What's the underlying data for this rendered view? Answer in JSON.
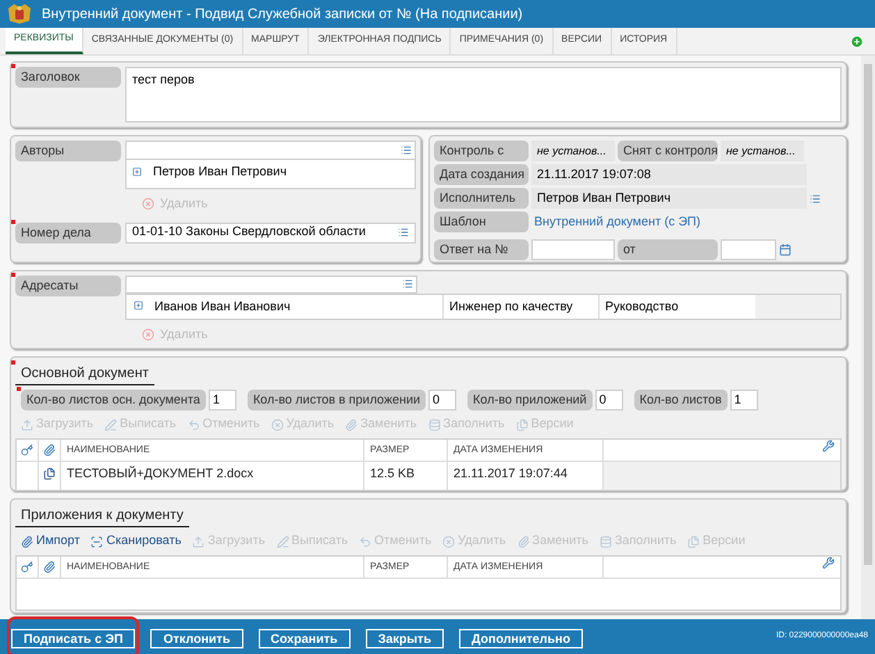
{
  "window": {
    "title": "Внутренний документ - Подвид Служебной записки от № (На подписании)"
  },
  "tabs": [
    {
      "label": "РЕКВИЗИТЫ",
      "selected": true
    },
    {
      "label": "СВЯЗАННЫЕ ДОКУМЕНТЫ (0)",
      "selected": false
    },
    {
      "label": "МАРШРУТ",
      "selected": false
    },
    {
      "label": "ЭЛЕКТРОННАЯ ПОДПИСЬ",
      "selected": false
    },
    {
      "label": "ПРИМЕЧАНИЯ (0)",
      "selected": false
    },
    {
      "label": "ВЕРСИИ",
      "selected": false
    },
    {
      "label": "ИСТОРИЯ",
      "selected": false
    }
  ],
  "title_field": {
    "label": "Заголовок",
    "required": true,
    "value": "тест перов"
  },
  "authors": {
    "label": "Авторы",
    "required": false,
    "items": [
      "Петров Иван Петрович"
    ],
    "delete": {
      "label": "Удалить",
      "disabled": true
    }
  },
  "case_number": {
    "label": "Номер дела",
    "required": true,
    "value": "01-01-10 Законы Свердловской области"
  },
  "control": {
    "control_from": {
      "label": "Контроль с",
      "value": "не установ..."
    },
    "removed": {
      "label": "Снят с контроля",
      "value": "не установ..."
    },
    "created": {
      "label": "Дата создания",
      "value": "21.11.2017 19:07:08"
    },
    "executor": {
      "label": "Исполнитель",
      "value": "Петров Иван Петрович"
    },
    "template": {
      "label": "Шаблон",
      "value": "Внутренний документ (с ЭП)"
    },
    "reply": {
      "label": "Ответ на №",
      "from_label": "от"
    }
  },
  "addressees": {
    "label": "Адресаты",
    "required": true,
    "rows": [
      {
        "name": "Иванов Иван Иванович",
        "position": "Инженер по качеству",
        "department": "Руководство"
      }
    ],
    "delete": {
      "label": "Удалить",
      "disabled": true
    }
  },
  "main_document": {
    "title": "Основной документ",
    "required": true,
    "counts": [
      {
        "label": "Кол-во листов осн. документа",
        "value": "1",
        "required": true
      },
      {
        "label": "Кол-во листов в приложении",
        "value": "0",
        "required": false
      },
      {
        "label": "Кол-во приложений",
        "value": "0",
        "required": false
      },
      {
        "label": "Кол-во листов",
        "value": "1",
        "required": false
      }
    ],
    "toolbar": [
      {
        "kind": "upload",
        "label": "Загрузить",
        "disabled": true
      },
      {
        "kind": "checkout",
        "label": "Выписать",
        "disabled": true
      },
      {
        "kind": "cancel",
        "label": "Отменить",
        "disabled": true
      },
      {
        "kind": "delete",
        "label": "Удалить",
        "disabled": true
      },
      {
        "kind": "replace",
        "label": "Заменить",
        "disabled": true
      },
      {
        "kind": "fill",
        "label": "Заполнить",
        "disabled": true
      },
      {
        "kind": "versions",
        "label": "Версии",
        "disabled": true
      }
    ],
    "columns": [
      "НАИМЕНОВАНИЕ",
      "РАЗМЕР",
      "ДАТА ИЗМЕНЕНИЯ"
    ],
    "rows": [
      {
        "name": "ТЕСТОВЫЙ+ДОКУМЕНТ 2.docx",
        "size": "12.5 KB",
        "modified": "21.11.2017 19:07:44"
      }
    ]
  },
  "attachments": {
    "title": "Приложения к документу",
    "toolbar": [
      {
        "kind": "import",
        "label": "Импорт",
        "disabled": false
      },
      {
        "kind": "scan",
        "label": "Сканировать",
        "disabled": false
      },
      {
        "kind": "upload",
        "label": "Загрузить",
        "disabled": true
      },
      {
        "kind": "checkout",
        "label": "Выписать",
        "disabled": true
      },
      {
        "kind": "cancel",
        "label": "Отменить",
        "disabled": true
      },
      {
        "kind": "delete",
        "label": "Удалить",
        "disabled": true
      },
      {
        "kind": "replace",
        "label": "Заменить",
        "disabled": true
      },
      {
        "kind": "fill",
        "label": "Заполнить",
        "disabled": true
      },
      {
        "kind": "versions",
        "label": "Версии",
        "disabled": true
      }
    ],
    "columns": [
      "НАИМЕНОВАНИЕ",
      "РАЗМЕР",
      "ДАТА ИЗМЕНЕНИЯ"
    ]
  },
  "footer": {
    "buttons": [
      {
        "label": "Подписать с ЭП",
        "highlighted": true
      },
      {
        "label": "Отклонить",
        "highlighted": false
      },
      {
        "label": "Сохранить",
        "highlighted": false
      },
      {
        "label": "Закрыть",
        "highlighted": false
      },
      {
        "label": "Дополнительно",
        "highlighted": false
      }
    ],
    "id_text": "ID: 0229000000000ea48"
  }
}
